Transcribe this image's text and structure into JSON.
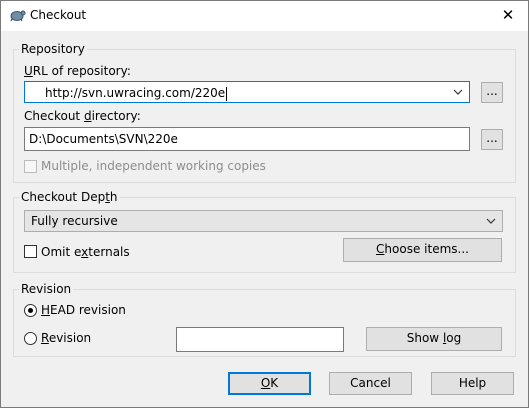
{
  "window": {
    "title": "Checkout",
    "close_glyph": "✕"
  },
  "repository": {
    "group_label": "Repository",
    "url_label": "URL of repository:",
    "url_label_mnemonic": "U",
    "url_label_rest": "RL of repository:",
    "url_value": "http://svn.uwracing.com/220e",
    "url_browse": "...",
    "dir_label_prefix": "Checkout ",
    "dir_label_mnemonic": "d",
    "dir_label_rest": "irectory:",
    "dir_value": "D:\\Documents\\SVN\\220e",
    "dir_browse": "...",
    "multi_wc_label": "Multiple, independent working copies",
    "multi_wc_checked": false
  },
  "depth": {
    "group_label_prefix": "Checkout Dep",
    "group_label_mnemonic": "t",
    "group_label_rest": "h",
    "selected": "Fully recursive",
    "omit_prefix": "Omit e",
    "omit_mnemonic": "x",
    "omit_rest": "ternals",
    "omit_checked": false,
    "choose_prefix": "",
    "choose_mnemonic": "C",
    "choose_rest": "hoose items..."
  },
  "revision": {
    "group_label": "Revision",
    "head_mnemonic": "H",
    "head_rest": "EAD revision",
    "head_selected": true,
    "rev_mnemonic": "R",
    "rev_rest": "evision",
    "rev_value": "",
    "showlog_prefix": "Show ",
    "showlog_mnemonic": "l",
    "showlog_rest": "og"
  },
  "buttons": {
    "ok_mnemonic": "O",
    "ok_rest": "K",
    "cancel": "Cancel",
    "help": "Help"
  }
}
